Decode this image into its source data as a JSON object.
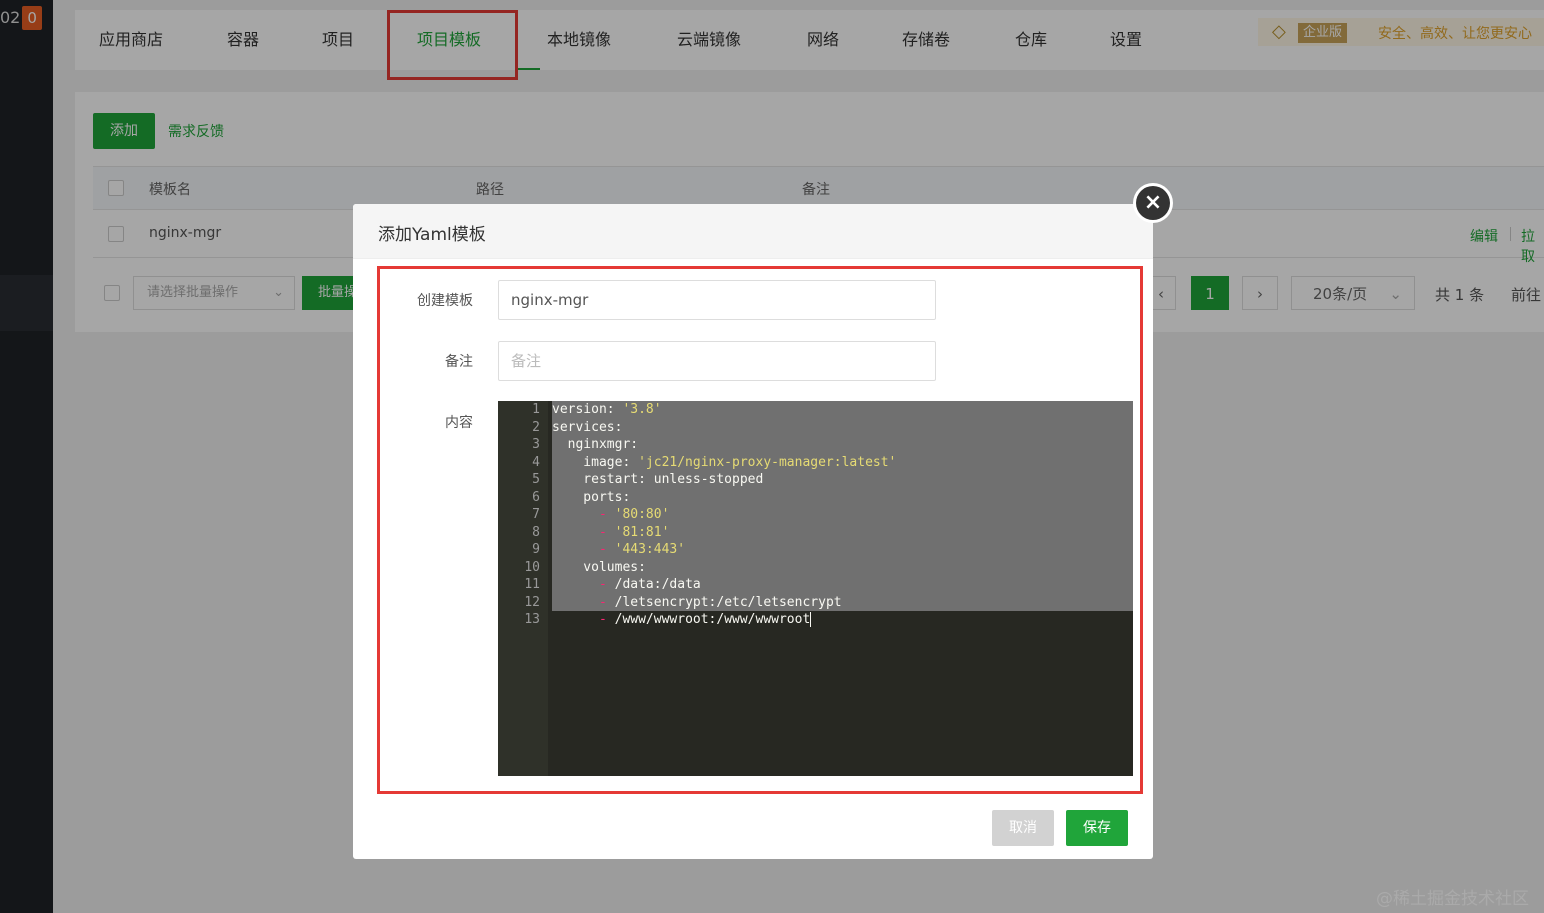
{
  "sidebar": {
    "counter": "02",
    "badge": "0"
  },
  "nav": {
    "tabs": [
      "应用商店",
      "容器",
      "项目",
      "项目模板",
      "本地镜像",
      "云端镜像",
      "网络",
      "存储卷",
      "仓库",
      "设置"
    ],
    "active": "项目模板",
    "promo_badge": "企业版",
    "promo_text": "安全、高效、让您更安心"
  },
  "toolbar": {
    "add_label": "添加",
    "feedback_label": "需求反馈"
  },
  "table": {
    "columns": [
      "模板名",
      "路径",
      "备注"
    ],
    "rows": [
      {
        "name": "nginx-mgr",
        "actions": [
          "编辑",
          "拉取"
        ]
      }
    ]
  },
  "batch": {
    "placeholder": "请选择批量操作",
    "button": "批量操作"
  },
  "pagination": {
    "prev": "‹",
    "current": "1",
    "next": "›",
    "page_size": "20条/页",
    "total": "共 1 条",
    "goto": "前往"
  },
  "modal": {
    "title": "添加Yaml模板",
    "close_icon": "×",
    "fields": {
      "name_label": "创建模板",
      "name_value": "nginx-mgr",
      "remark_label": "备注",
      "remark_placeholder": "备注",
      "content_label": "内容"
    },
    "yaml_lines": [
      "version: '3.8'",
      "services:",
      "  nginxmgr:",
      "    image: 'jc21/nginx-proxy-manager:latest'",
      "    restart: unless-stopped",
      "    ports:",
      "      - '80:80'",
      "      - '81:81'",
      "      - '443:443'",
      "    volumes:",
      "      - /data:/data",
      "      - /letsencrypt:/etc/letsencrypt",
      "      - /www/wwwroot:/www/wwwroot"
    ],
    "cancel_label": "取消",
    "save_label": "保存"
  },
  "watermark": "@稀土掘金技术社区",
  "colors": {
    "accent": "#20a53a",
    "highlight_border": "#e53935",
    "editor_bg": "#272822"
  }
}
